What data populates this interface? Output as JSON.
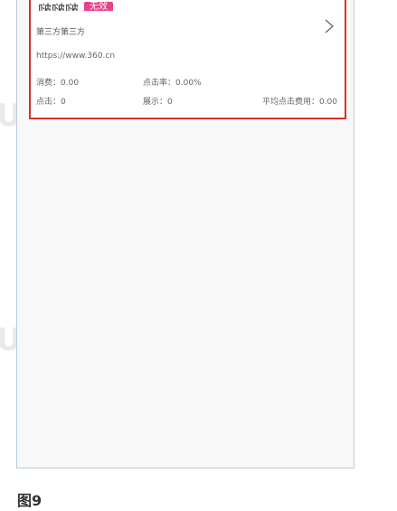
{
  "card": {
    "title": "啵啵啵",
    "badge": "无效",
    "subtitle": "第三方第三方",
    "url": "https://www.360.cn",
    "stats": {
      "spend": "消费：0.00",
      "ctr": "点击率：0.00%",
      "clicks": "点击：0",
      "impressions": "展示：0",
      "avg_cpc": "平均点击费用：0.00"
    }
  },
  "watermark": "U",
  "caption": "图9",
  "colors": {
    "highlight_border": "#d9302a",
    "badge_bg": "#e8408a",
    "phone_border": "#b9ccd9"
  },
  "icons": {
    "chevron": "chevron-right-icon"
  }
}
